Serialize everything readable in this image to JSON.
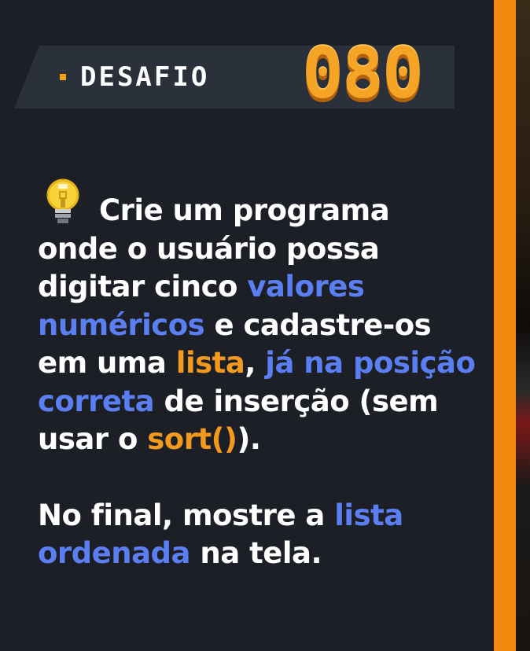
{
  "header": {
    "label": "DESAFIO",
    "number": "080"
  },
  "icon": "lightbulb-icon",
  "paragraph1": {
    "t1": "Crie um programa onde o usuário possa digitar cinco ",
    "h1": "valores numéricos",
    "t2": " e cadastre-os em uma ",
    "h2": "lista",
    "t3": ", ",
    "h3": "já na posição correta",
    "t4": " de inserção (sem usar o ",
    "h4": "sort()",
    "t5": ")."
  },
  "paragraph2": {
    "t1": "No final, mostre a ",
    "h1": "lista ordenada",
    "t2": " na tela."
  },
  "colors": {
    "background": "#1c2026",
    "accent_orange": "#f39a1e",
    "accent_blue": "#5b7ff2",
    "text": "#ffffff"
  }
}
